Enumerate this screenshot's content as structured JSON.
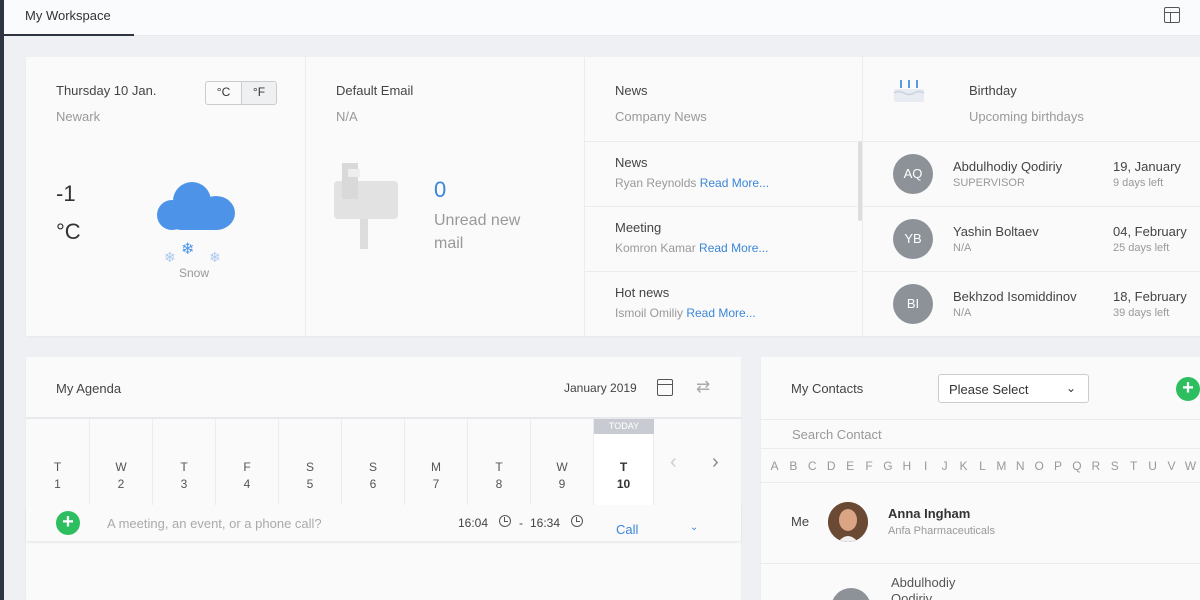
{
  "header": {
    "tab_label": "My Workspace",
    "layout_icon": "layout-icon"
  },
  "weather": {
    "date": "Thursday 10 Jan.",
    "city": "Newark",
    "unit_c": "°C",
    "unit_f": "°F",
    "temperature": "-1",
    "temp_unit": "°C",
    "condition": "Snow",
    "icon": "snow-cloud-icon",
    "icon_color": "#4d94e9"
  },
  "email": {
    "title": "Default Email",
    "address": "N/A",
    "unread_count": "0",
    "unread_label": "Unread new mail",
    "icon": "mailbox-icon"
  },
  "news": {
    "title": "News",
    "subtitle": "Company News",
    "read_more": "Read More...",
    "items": [
      {
        "title": "News",
        "author": "Ryan Reynolds"
      },
      {
        "title": "Meeting",
        "author": "Komron Kamar"
      },
      {
        "title": "Hot news",
        "author": "Ismoil Omiliy"
      }
    ]
  },
  "birthday": {
    "title": "Birthday",
    "subtitle": "Upcoming birthdays",
    "icon": "birthday-cake-icon",
    "items": [
      {
        "initials": "AQ",
        "name": "Abdulhodiy Qodiriy",
        "role": "SUPERVISOR",
        "date": "19, January",
        "days_left": "9 days left"
      },
      {
        "initials": "YB",
        "name": "Yashin Boltaev",
        "role": "N/A",
        "date": "04, February",
        "days_left": "25 days left"
      },
      {
        "initials": "BI",
        "name": "Bekhzod Isomiddinov",
        "role": "N/A",
        "date": "18, February",
        "days_left": "39 days left"
      }
    ]
  },
  "agenda": {
    "title": "My Agenda",
    "month": "January 2019",
    "today_badge": "TODAY",
    "days": [
      {
        "letter": "T",
        "num": "1"
      },
      {
        "letter": "W",
        "num": "2"
      },
      {
        "letter": "T",
        "num": "3"
      },
      {
        "letter": "F",
        "num": "4"
      },
      {
        "letter": "S",
        "num": "5"
      },
      {
        "letter": "S",
        "num": "6"
      },
      {
        "letter": "M",
        "num": "7"
      },
      {
        "letter": "T",
        "num": "8"
      },
      {
        "letter": "W",
        "num": "9"
      },
      {
        "letter": "T",
        "num": "10"
      }
    ],
    "input_placeholder": "A meeting, an event, or a phone call?",
    "start_time": "16:04",
    "separator": "-",
    "end_time": "16:34",
    "type": "Call",
    "accent_color": "#2dbe60"
  },
  "contacts": {
    "title": "My Contacts",
    "select_value": "Please Select",
    "search_placeholder": "Search Contact",
    "alphabet": [
      "A",
      "B",
      "C",
      "D",
      "E",
      "F",
      "G",
      "H",
      "I",
      "J",
      "K",
      "L",
      "M",
      "N",
      "O",
      "P",
      "Q",
      "R",
      "S",
      "T",
      "U",
      "V",
      "W"
    ],
    "me_label": "Me",
    "me": {
      "name": "Anna Ingham",
      "company": "Anfa Pharmaceuticals"
    },
    "next": {
      "name": "Abdulhodiy Qodiriy"
    }
  }
}
